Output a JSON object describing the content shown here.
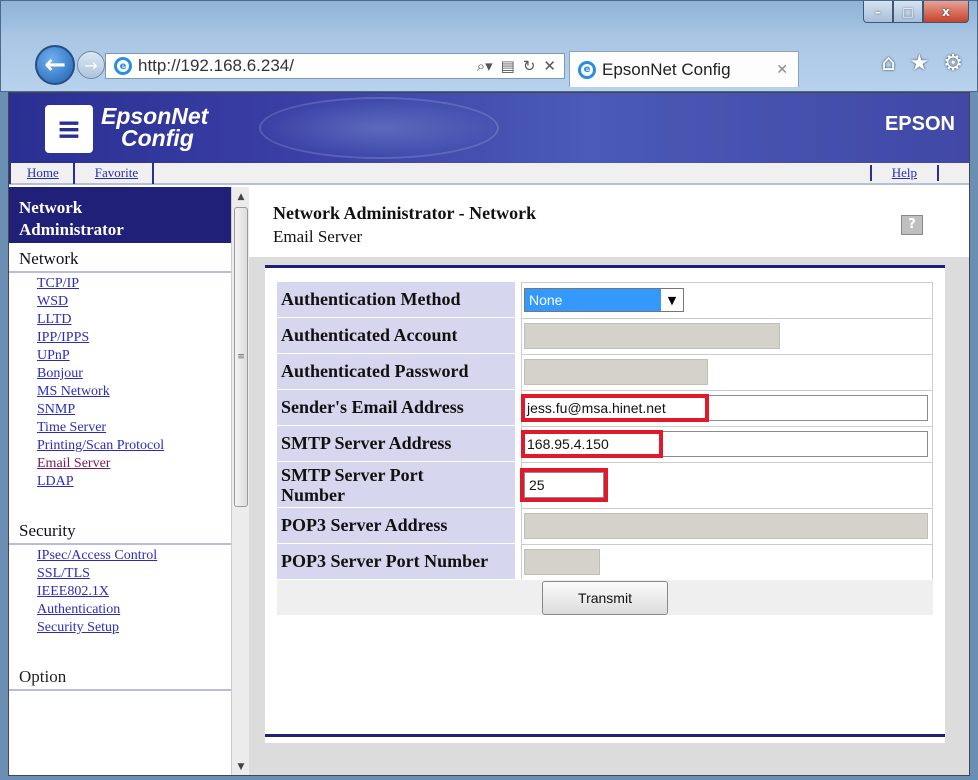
{
  "browser": {
    "url": "http://192.168.6.234/",
    "tab_title": "EpsonNet Config",
    "controls": {
      "minimize": "–",
      "maximize": "□",
      "close": "x"
    },
    "icons": [
      "back-arrow-icon",
      "forward-arrow-icon",
      "ie-icon",
      "search-icon",
      "refresh-icon",
      "stop-icon",
      "home-icon",
      "star-icon",
      "gear-icon"
    ]
  },
  "banner": {
    "logo_line1": "EpsonNet",
    "logo_line2": "Config",
    "brand": "EPSON"
  },
  "linkbar": {
    "home": "Home",
    "favorite": "Favorite",
    "help": "Help"
  },
  "sidebar": {
    "title_line1": "Network",
    "title_line2": "Administrator",
    "sections": [
      {
        "label": "Network",
        "links": [
          "TCP/IP",
          "WSD",
          "LLTD",
          "IPP/IPPS",
          "UPnP",
          "Bonjour",
          "MS Network",
          "SNMP",
          "Time Server",
          "Printing/Scan Protocol",
          "Email Server",
          "LDAP"
        ]
      },
      {
        "label": "Security",
        "links": [
          "IPsec/Access Control",
          "SSL/TLS",
          "IEEE802.1X",
          "Authentication",
          "Security Setup"
        ]
      },
      {
        "label": "Option"
      }
    ],
    "active_link": "Email Server"
  },
  "main": {
    "title": "Network Administrator - Network",
    "subtitle": "Email Server",
    "help_icon": "?",
    "form": {
      "auth_method_label": "Authentication Method",
      "auth_method_value": "None",
      "auth_account_label": "Authenticated Account",
      "auth_password_label": "Authenticated Password",
      "sender_label": "Sender's Email Address",
      "sender_value": "jess.fu@msa.hinet.net",
      "smtp_addr_label": "SMTP Server Address",
      "smtp_addr_value": "168.95.4.150",
      "smtp_port_label_1": "SMTP Server Port",
      "smtp_port_label_2": "Number",
      "smtp_port_value": "25",
      "pop3_addr_label": "POP3 Server Address",
      "pop3_port_label": "POP3 Server Port Number"
    },
    "transmit_label": "Transmit"
  },
  "colors": {
    "banner": "#2a2f92",
    "sidebar_title": "#202078",
    "label_bg": "#d6d6ee",
    "highlight": "#e0192b",
    "select_bg": "#3399ff",
    "link": "#2b2bbf"
  }
}
